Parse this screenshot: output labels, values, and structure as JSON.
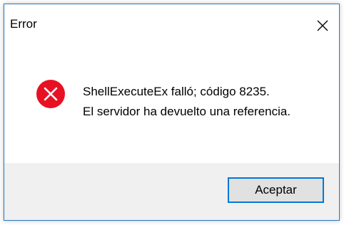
{
  "window": {
    "title": "Error",
    "close_icon": "close-icon"
  },
  "message": {
    "icon": "error-icon",
    "icon_color": "#e81123",
    "line1": "ShellExecuteEx falló; código 8235.",
    "line2": "El servidor ha devuelto una referencia."
  },
  "buttons": {
    "ok_label": "Aceptar"
  },
  "colors": {
    "accent": "#0078d7",
    "footer_bg": "#f0f0f0"
  }
}
